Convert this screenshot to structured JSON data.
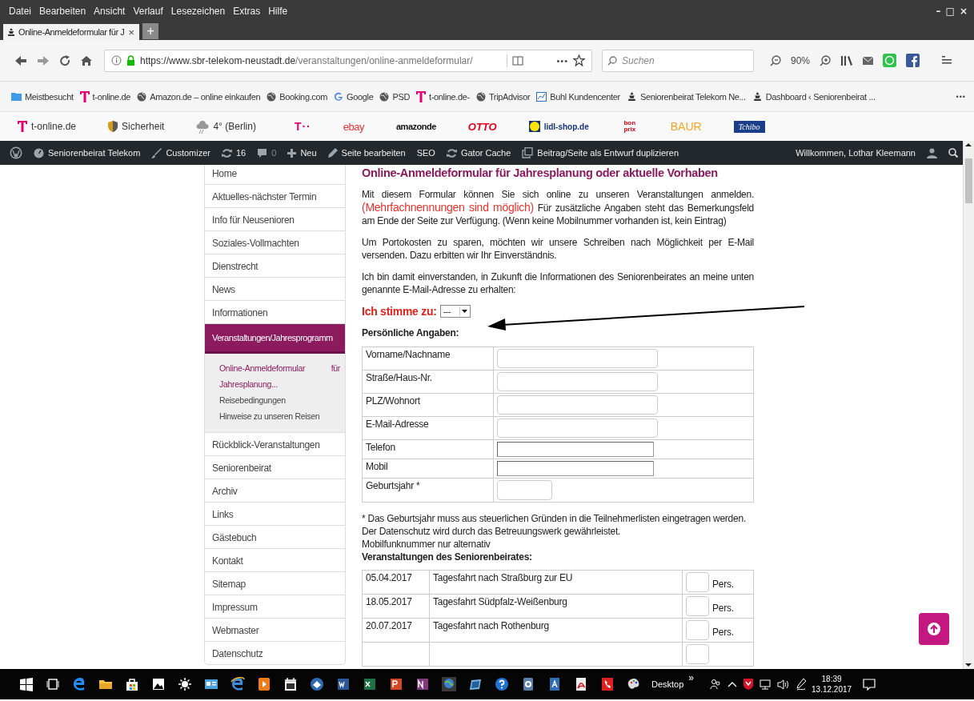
{
  "menu": [
    "Datei",
    "Bearbeiten",
    "Ansicht",
    "Verlauf",
    "Lesezeichen",
    "Extras",
    "Hilfe"
  ],
  "window_controls": [
    "–",
    "□",
    "×"
  ],
  "tab": {
    "title": "Online-Anmeldeformular für J",
    "close": "×",
    "selected": true
  },
  "new_tab": "+",
  "address": {
    "host": "https://www.sbr-telekom-neustadt.de",
    "path": "/veranstaltungen/online-anmeldeformular/"
  },
  "page_actions": "•••",
  "search": {
    "placeholder": "Suchen"
  },
  "zoom": "90%",
  "bookmarks": [
    {
      "label": "Meistbesucht",
      "kind": "folder"
    },
    {
      "label": "t-online.de",
      "kind": "telekom"
    },
    {
      "label": "Amazon.de – online einkaufen",
      "kind": "globe"
    },
    {
      "label": "Booking.com",
      "kind": "globe"
    },
    {
      "label": "Google",
      "kind": "google"
    },
    {
      "label": "PSD",
      "kind": "globe"
    },
    {
      "label": "t-online.de-",
      "kind": "telekom"
    },
    {
      "label": "TripAdvisor",
      "kind": "globe"
    },
    {
      "label": "Buhl Kundencenter",
      "kind": "buhl"
    },
    {
      "label": "Seniorenbeirat Telekom  Ne...",
      "kind": "site"
    },
    {
      "label": "Dashboard ‹ Seniorenbeirat ...",
      "kind": "site"
    }
  ],
  "more_bookmarks": "•••",
  "quicklinks": [
    {
      "label": "t-online.de",
      "kind": "telekom"
    },
    {
      "label": "Sicherheit",
      "kind": "shield"
    },
    {
      "label": "4° (Berlin)",
      "kind": "weather"
    },
    {
      "label": "T··",
      "kind": "magenta"
    },
    {
      "label": "ebay",
      "kind": "ebay"
    },
    {
      "label": "amazonde",
      "kind": "amazon"
    },
    {
      "label": "OTTO",
      "kind": "otto"
    },
    {
      "label": "lidl-shop.de",
      "kind": "lidl"
    },
    {
      "label": "bon prix",
      "kind": "bonprix"
    },
    {
      "label": "BAUR",
      "kind": "baur"
    },
    {
      "label": "Tchibo",
      "kind": "tchibo"
    }
  ],
  "admin_bar": {
    "items": [
      {
        "label": "Seniorenbeirat Telekom",
        "kind": "dashboard"
      },
      {
        "label": "Customizer",
        "kind": "brush"
      },
      {
        "label": "16",
        "kind": "updates"
      },
      {
        "label": "0",
        "kind": "comments"
      },
      {
        "label": "Neu",
        "kind": "plus"
      },
      {
        "label": "Seite bearbeiten",
        "kind": "pencil"
      },
      {
        "label": "SEO",
        "kind": "text"
      },
      {
        "label": "Gator Cache",
        "kind": "updates"
      },
      {
        "label": "Beitrag/Seite als Entwurf duplizieren",
        "kind": "copy"
      }
    ],
    "greeting": "Willkommen, Lothar Kleemann"
  },
  "sidebar": {
    "items": [
      {
        "label": "Home",
        "selected": false
      },
      {
        "label": "Aktuelles-nächster Termin",
        "selected": false
      },
      {
        "label": "Info für Neusenioren",
        "selected": false
      },
      {
        "label": "Soziales-Vollmachten",
        "selected": false
      },
      {
        "label": "Dienstrecht",
        "selected": false
      },
      {
        "label": "News",
        "selected": false
      },
      {
        "label": "Informationen",
        "selected": false
      },
      {
        "label": "Veranstaltungen/Jahresprogramm",
        "selected": true,
        "children": [
          {
            "label": "Online-Anmeldeformular für Jahresplanung...",
            "selected": true
          },
          {
            "label": "Reisebedingungen",
            "selected": false
          },
          {
            "label": "Hinweise zu unseren Reisen",
            "selected": false
          }
        ]
      },
      {
        "label": "Rückblick-Veranstaltungen",
        "selected": false
      },
      {
        "label": "Seniorenbeirat",
        "selected": false
      },
      {
        "label": "Archiv",
        "selected": false
      },
      {
        "label": "Links",
        "selected": false
      },
      {
        "label": "Gästebuch",
        "selected": false
      },
      {
        "label": "Kontakt",
        "selected": false
      },
      {
        "label": "Sitemap",
        "selected": false
      },
      {
        "label": "Impressum",
        "selected": false
      },
      {
        "label": "Webmaster",
        "selected": false
      },
      {
        "label": "Datenschutz",
        "selected": false
      }
    ]
  },
  "form": {
    "title": "Online-Anmeldeformular für Jahresplanung oder aktuelle Vorhaben",
    "intro": {
      "lead": "Mit diesem Formular können Sie sich online zu unseren Veranstaltungen anmelden.",
      "highlight": "(Mehrfachnennungen sind möglich)",
      "rest": "Für zusätzliche Angaben steht das Bemerkungsfeld am Ende der Seite zur Verfügung. (Wenn keine Mobilnummer vorhanden ist, kein Eintrag)"
    },
    "paragraphs": [
      "Um Portokosten zu sparen, möchten wir unsere Schreiben nach Möglichkeit per E-Mail versenden. Dazu erbitten wir Ihr Einverständnis.",
      "Ich bin damit einverstanden, in Zukunft die Informationen des Seniorenbeirates an meine unten genannte E-Mail-Adresse zu erhalten:"
    ],
    "consent": {
      "label": "Ich stimme zu:",
      "value": "---"
    },
    "personal": {
      "heading": "Persönliche Angaben:",
      "fields": [
        {
          "label": "Vorname/Nachname",
          "kind": "rounded"
        },
        {
          "label": "Straße/Haus-Nr.",
          "kind": "rounded"
        },
        {
          "label": "PLZ/Wohnort",
          "kind": "rounded"
        },
        {
          "label": "E-Mail-Adresse",
          "kind": "rounded"
        },
        {
          "label": "Telefon",
          "kind": "plain"
        },
        {
          "label": "Mobil",
          "kind": "plain"
        },
        {
          "label": "Geburtsjahr *",
          "kind": "short"
        }
      ]
    },
    "notes": [
      "* Das Geburtsjahr muss aus steuerlichen Gründen in die Teilnehmerlisten eingetragen werden.",
      "Der Datenschutz wird durch das Betreuungswerk gewährleistet.",
      "Mobilfunknummer nur alternativ"
    ],
    "events": {
      "heading": "Veranstaltungen des Seniorenbeirates:",
      "rows": [
        {
          "date": "05.04.2017",
          "title": "Tagesfahrt nach Straßburg zur EU",
          "unit": "Pers."
        },
        {
          "date": "18.05.2017",
          "title": "Tagesfahrt Südpfalz-Weißenburg",
          "unit": "Pers."
        },
        {
          "date": "20.07.2017",
          "title": "Tagesfahrt nach Rothenburg",
          "unit": "Pers."
        }
      ]
    }
  },
  "taskbar": {
    "desktop": "Desktop",
    "chevron": "»",
    "time": "18:39",
    "date": "13.12.2017"
  }
}
